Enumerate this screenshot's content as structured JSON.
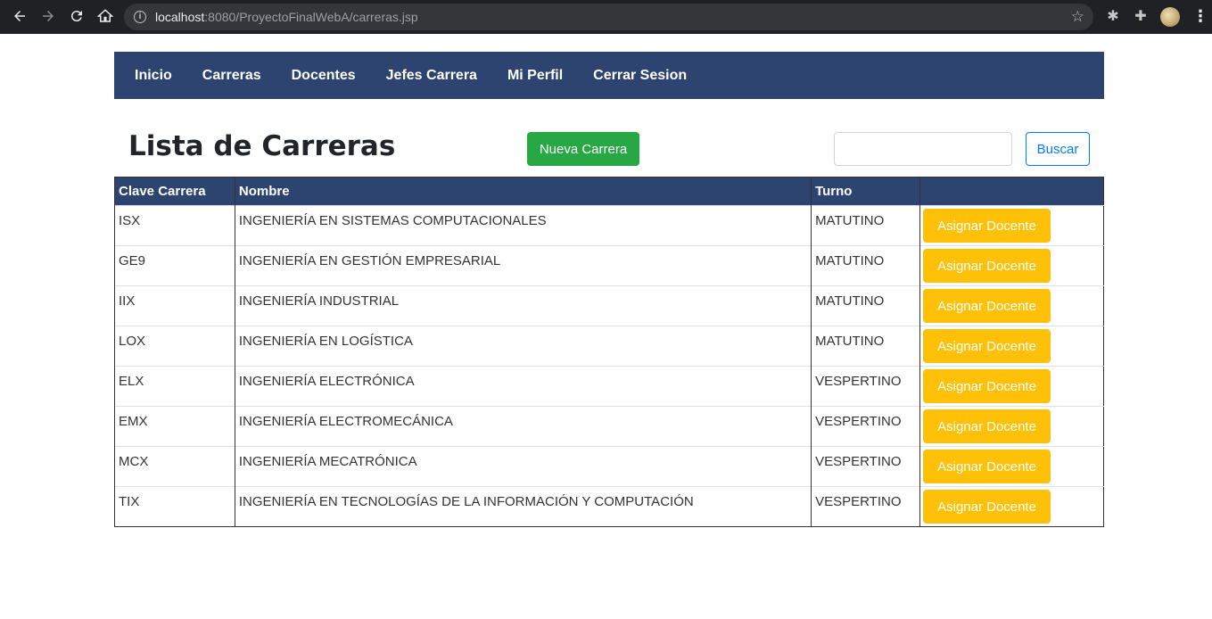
{
  "browser": {
    "url_host": "localhost",
    "url_rest": ":8080/ProyectoFinalWebA/carreras.jsp"
  },
  "navbar": {
    "items": [
      "Inicio",
      "Carreras",
      "Docentes",
      "Jefes Carrera",
      "Mi Perfil",
      "Cerrar Sesion"
    ]
  },
  "header": {
    "title": "Lista de Carreras",
    "new_button": "Nueva Carrera",
    "search_placeholder": "",
    "search_button": "Buscar"
  },
  "table": {
    "columns": [
      "Clave Carrera",
      "Nombre",
      "Turno",
      ""
    ],
    "action_label": "Asignar Docente",
    "rows": [
      {
        "clave": "ISX",
        "nombre": "INGENIERÍA EN SISTEMAS COMPUTACIONALES",
        "turno": "MATUTINO"
      },
      {
        "clave": "GE9",
        "nombre": "INGENIERÍA EN GESTIÓN EMPRESARIAL",
        "turno": "MATUTINO"
      },
      {
        "clave": "IIX",
        "nombre": "INGENIERÍA INDUSTRIAL",
        "turno": "MATUTINO"
      },
      {
        "clave": "LOX",
        "nombre": "INGENIERÍA EN LOGÍSTICA",
        "turno": "MATUTINO"
      },
      {
        "clave": "ELX",
        "nombre": "INGENIERÍA ELECTRÓNICA",
        "turno": "VESPERTINO"
      },
      {
        "clave": "EMX",
        "nombre": "INGENIERÍA ELECTROMECÁNICA",
        "turno": "VESPERTINO"
      },
      {
        "clave": "MCX",
        "nombre": "INGENIERÍA MECATRÓNICA",
        "turno": "VESPERTINO"
      },
      {
        "clave": "TIX",
        "nombre": "INGENIERÍA EN TECNOLOGÍAS DE LA INFORMACIÓN Y COMPUTACIÓN",
        "turno": "VESPERTINO"
      }
    ]
  },
  "colors": {
    "navbar": "#2e4470",
    "success": "#28a745",
    "warning": "#ffc107",
    "primary": "#007bff"
  }
}
